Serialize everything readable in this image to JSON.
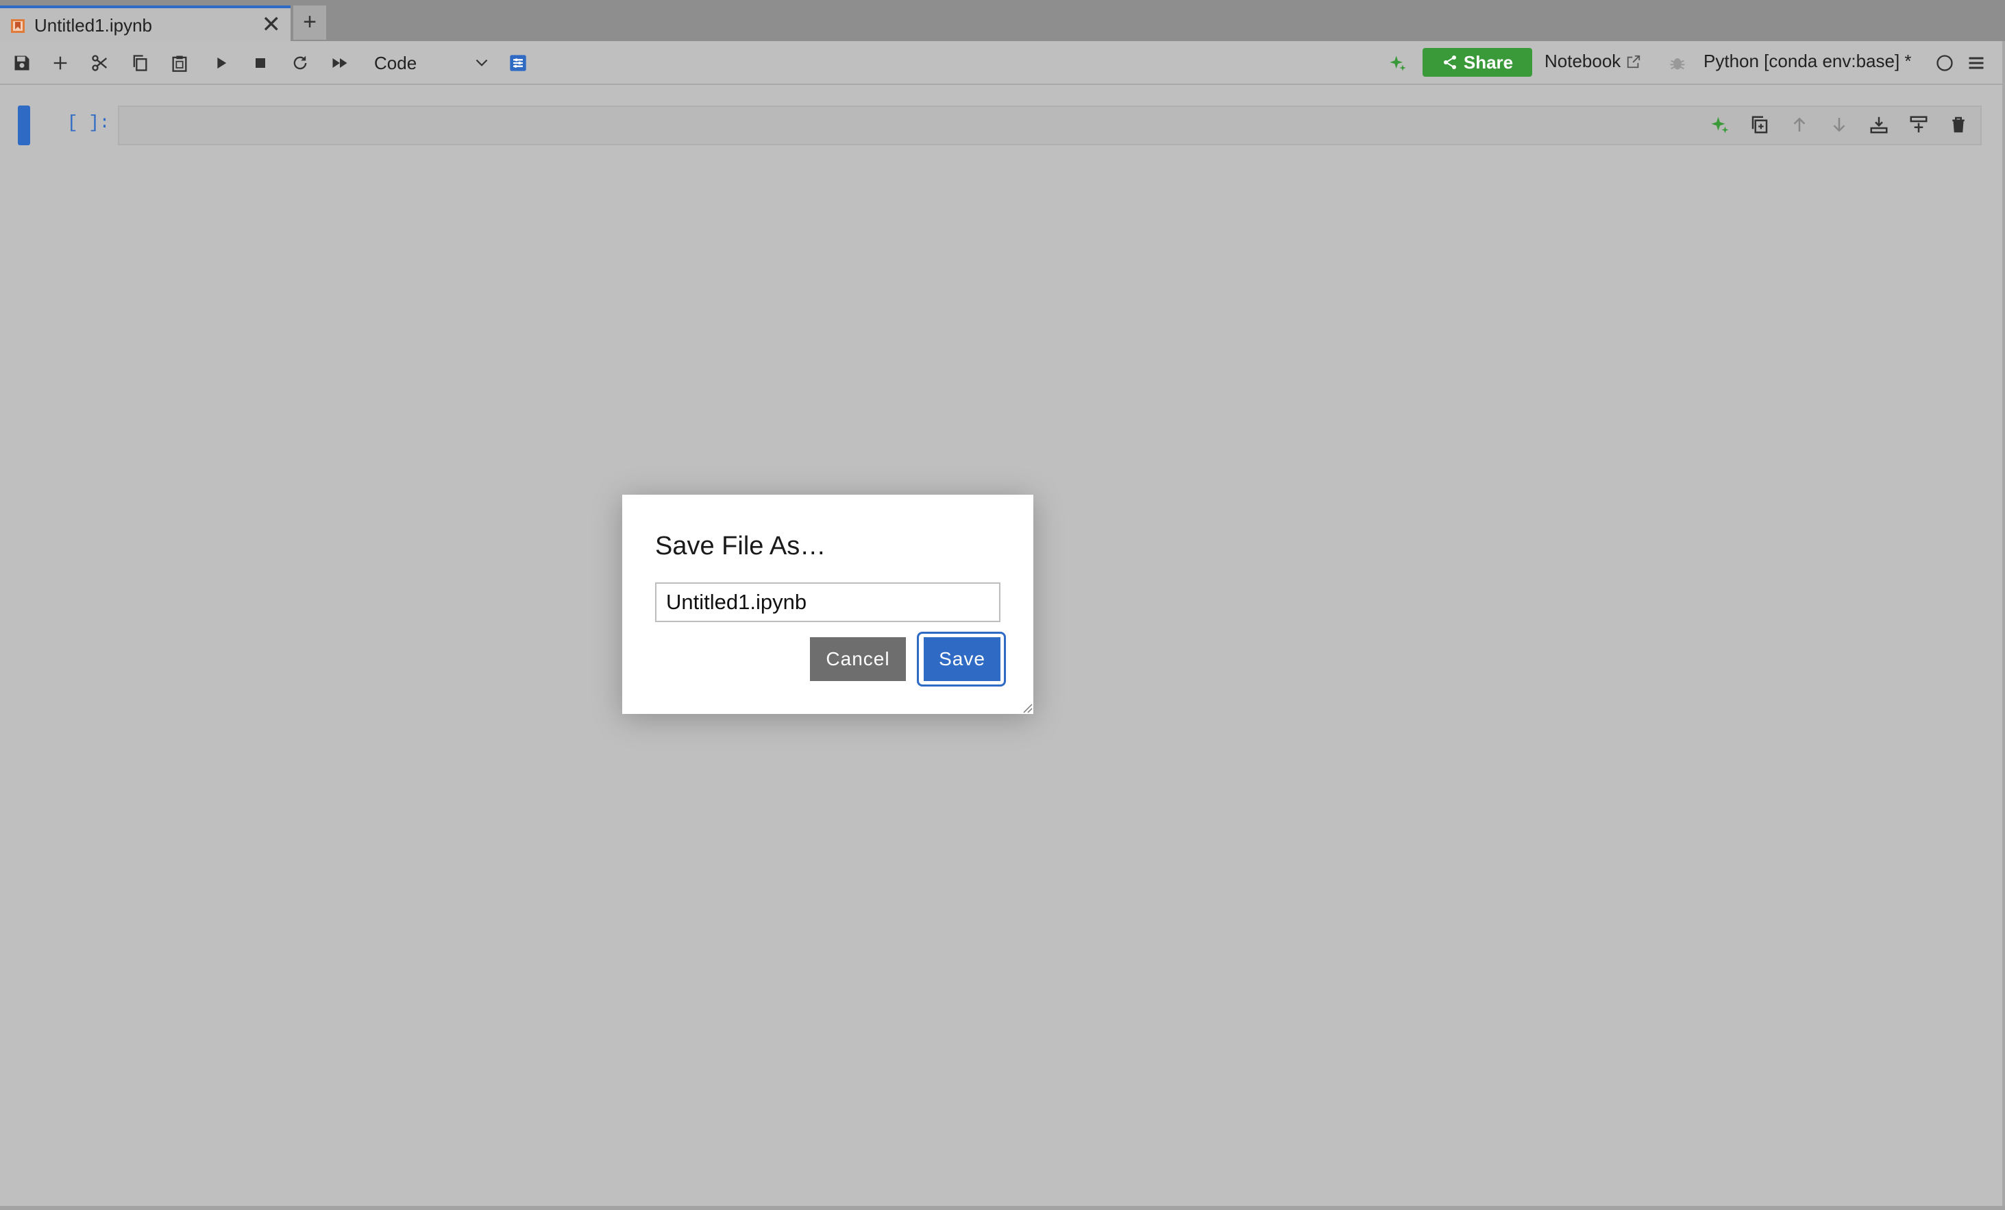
{
  "tab": {
    "title": "Untitled1.ipynb",
    "close_glyph": "✕",
    "new_tab_glyph": "+"
  },
  "toolbar": {
    "cell_type": "Code",
    "share_label": "Share",
    "notebook_label": "Notebook",
    "kernel_label": "Python [conda env:base] *",
    "icons": [
      "save-icon",
      "add-cell-icon",
      "cut-icon",
      "copy-icon",
      "paste-icon",
      "run-icon",
      "stop-icon",
      "restart-icon",
      "run-all-icon",
      "cell-type-chevron-icon",
      "property-inspector-icon",
      "ai-sparkle-icon",
      "share-icon",
      "external-link-icon",
      "debugger-icon",
      "kernel-status-icon",
      "menu-icon"
    ]
  },
  "cell": {
    "prompt": "[ ]:"
  },
  "dialog": {
    "title": "Save File As…",
    "filename_value": "Untitled1.ipynb",
    "cancel_label": "Cancel",
    "save_label": "Save"
  },
  "colors": {
    "accent": "#2f6bc5",
    "share_green": "#3a9a3a",
    "cancel_gray": "#6e6e6e",
    "background": "#bfbfbf"
  }
}
